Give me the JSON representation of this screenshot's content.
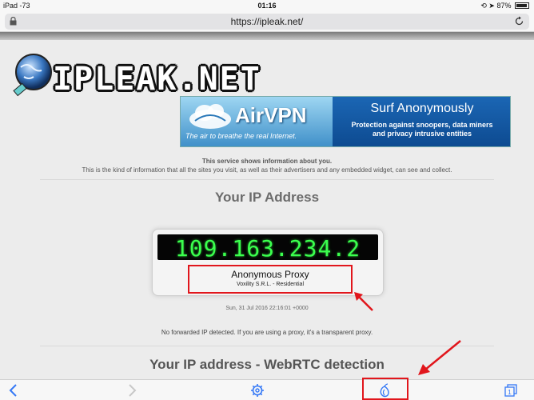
{
  "status_bar": {
    "left": "iPad -73",
    "time": "01:16",
    "right": "87%"
  },
  "url_bar": {
    "url": "https://ipleak.net/"
  },
  "header": {
    "logo_text": "IPLEAK.NET"
  },
  "banner": {
    "brand": "AirVPN",
    "tagline": "The air to breathe the real Internet.",
    "headline": "Surf Anonymously",
    "description_line1": "Protection against snoopers, data miners",
    "description_line2": "and privacy intrusive entities"
  },
  "service": {
    "title": "This service shows information about you.",
    "description": "This is the kind of information that all the sites you visit, as well as their advertisers and any embedded widget, can see and collect."
  },
  "ip_section": {
    "title": "Your IP Address",
    "ip": "109.163.234.2",
    "proxy_type": "Anonymous Proxy",
    "isp": "Voxility S.R.L. - Residential",
    "timestamp": "Sun, 31 Jul 2016 22:16:01 +0000",
    "forward_note": "No forwarded IP detected. If you are using a proxy, it's a transparent proxy."
  },
  "webrtc_section": {
    "title": "Your IP address - WebRTC detection"
  },
  "toolbar": {
    "tabs_count": "1"
  },
  "colors": {
    "annotation_red": "#e1161c",
    "ios_blue": "#3478f6",
    "lcd_green": "#3bff4e"
  }
}
